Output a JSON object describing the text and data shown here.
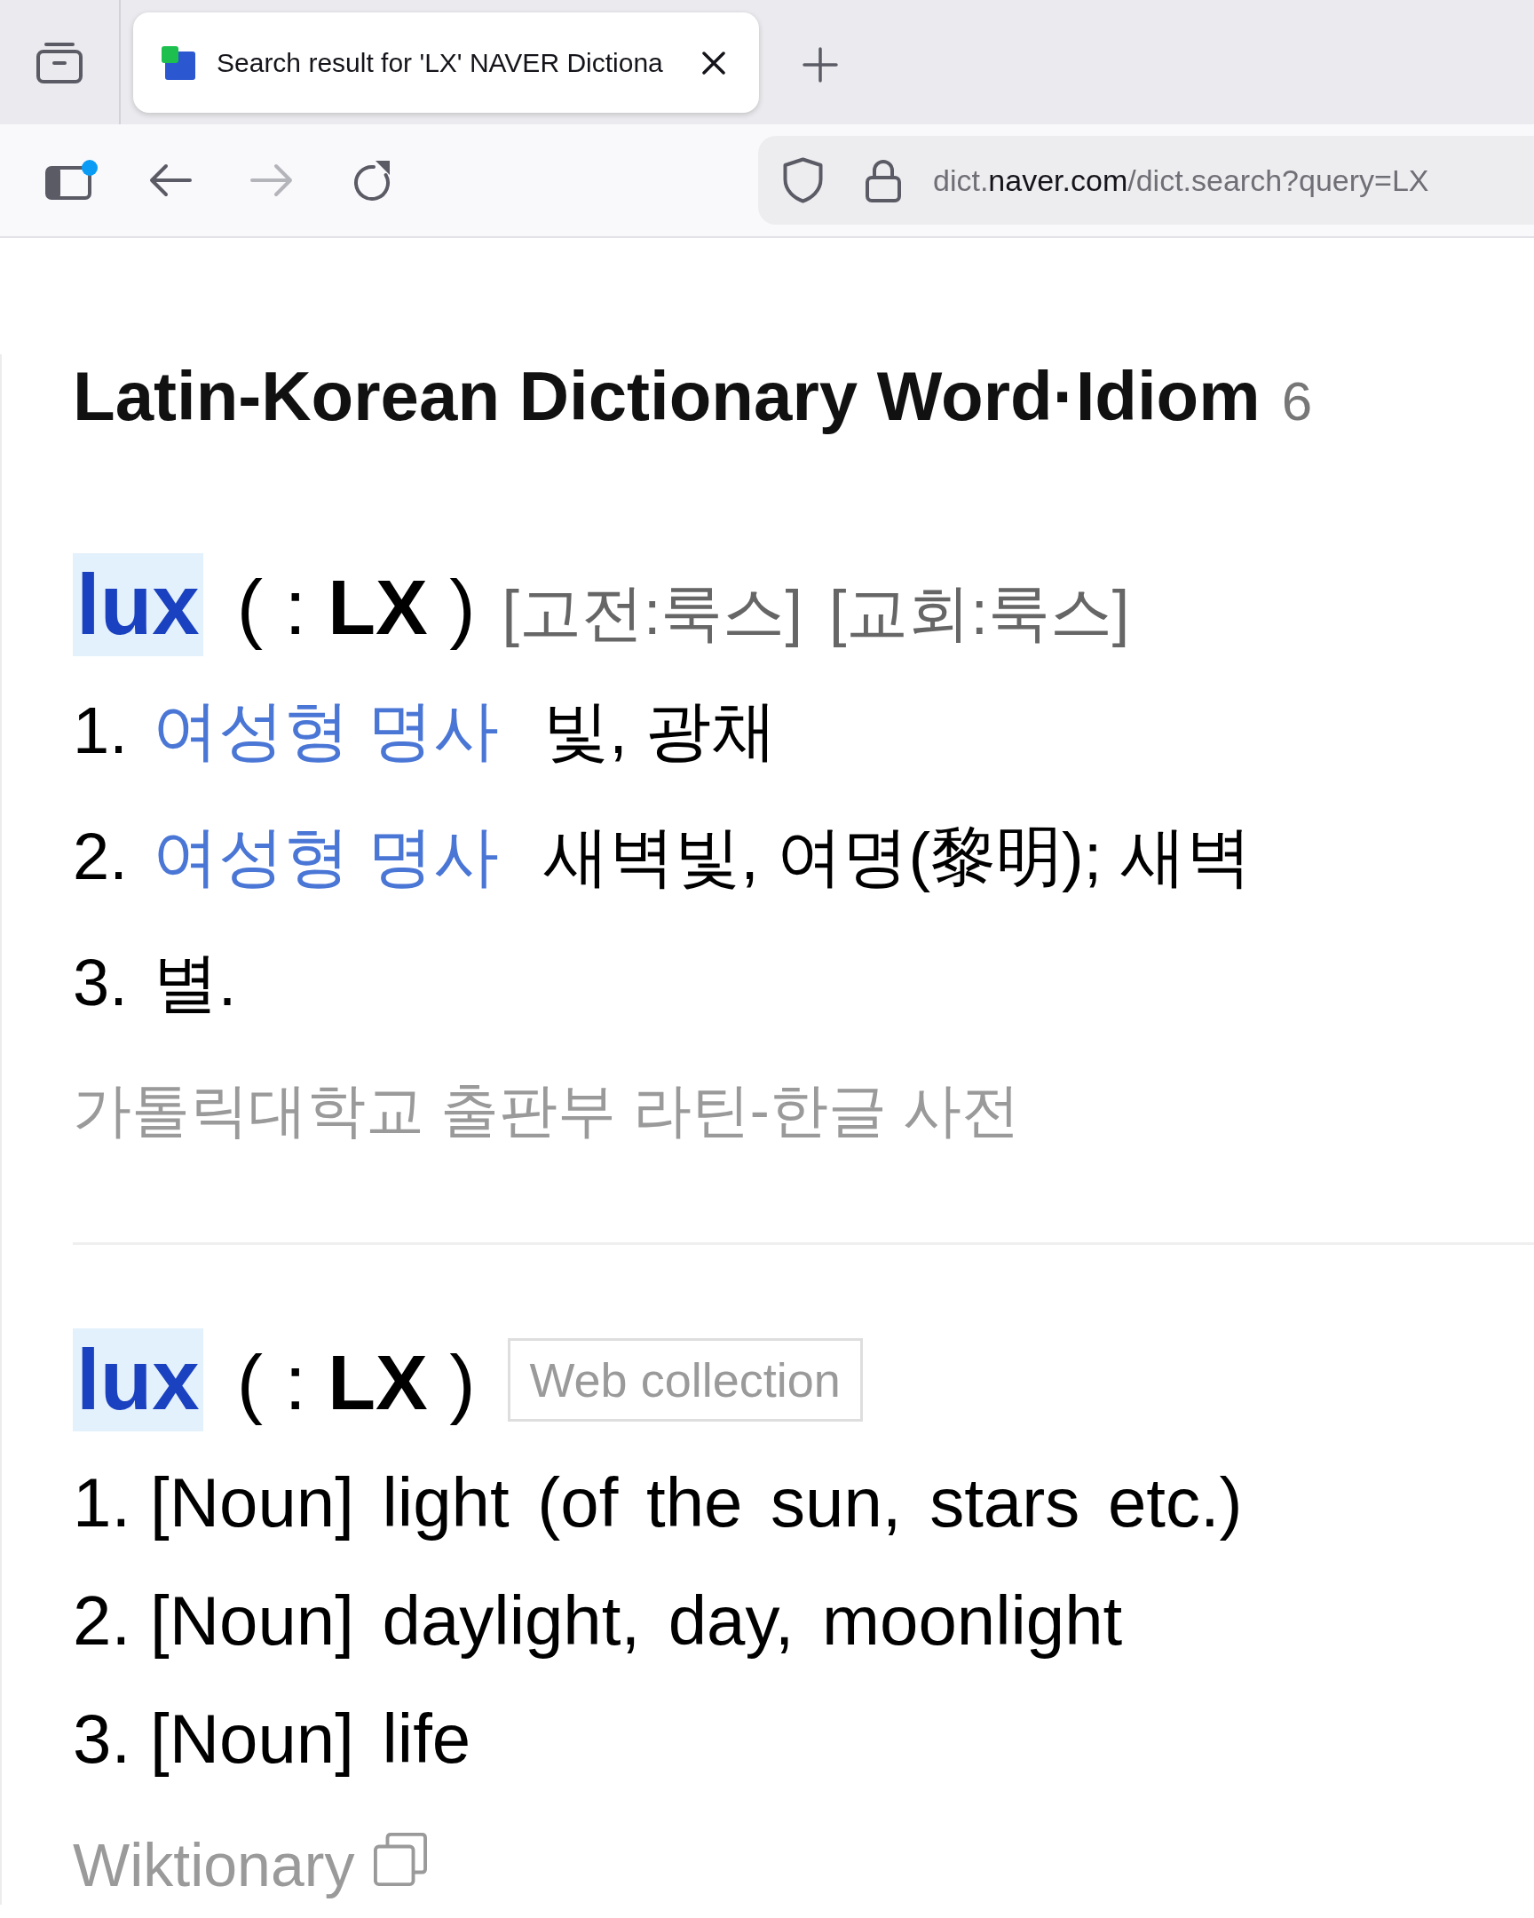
{
  "browser": {
    "tabs": [
      {
        "title": "Search result for 'LX' NAVER Dictiona",
        "selected": true
      }
    ],
    "sidebar_button": {
      "notification": true
    },
    "nav": {
      "back": {
        "disabled": false
      },
      "forward": {
        "disabled": true
      }
    },
    "address": {
      "subdomain": "dict.",
      "domain": "naver.com",
      "path": "/dict.search?query=LX"
    }
  },
  "section": {
    "title": "Latin-Korean Dictionary Word·Idiom",
    "count": "6",
    "entries": [
      {
        "kind": "dictionary",
        "headword": "lux",
        "highlighted": true,
        "spelling": "( : **LX** )",
        "pronunciations": [
          "[고전:룩스]",
          "[교회:룩스]"
        ],
        "senses": [
          {
            "number": "1.",
            "pos": "여성형 명사",
            "meaning": "빛, 광채"
          },
          {
            "number": "2.",
            "pos": "여성형 명사",
            "meaning": "새벽빛, 여명(黎明); 새벽"
          },
          {
            "number": "3.",
            "meaning": "별."
          }
        ],
        "source": {
          "name": "가톨릭대학교 출판부 라틴-한글 사전",
          "external": false
        }
      },
      {
        "kind": "web",
        "headword": "lux",
        "highlighted": true,
        "spelling": "( : **LX** )",
        "tag": "Web collection",
        "senses": [
          {
            "number": "1.",
            "meaning": "[Noun] light (of the sun, stars etc.)"
          },
          {
            "number": "2.",
            "meaning": "[Noun] daylight, day, moonlight"
          },
          {
            "number": "3.",
            "meaning": "[Noun] life"
          }
        ],
        "source": {
          "name": "Wiktionary",
          "external": true
        }
      }
    ]
  }
}
